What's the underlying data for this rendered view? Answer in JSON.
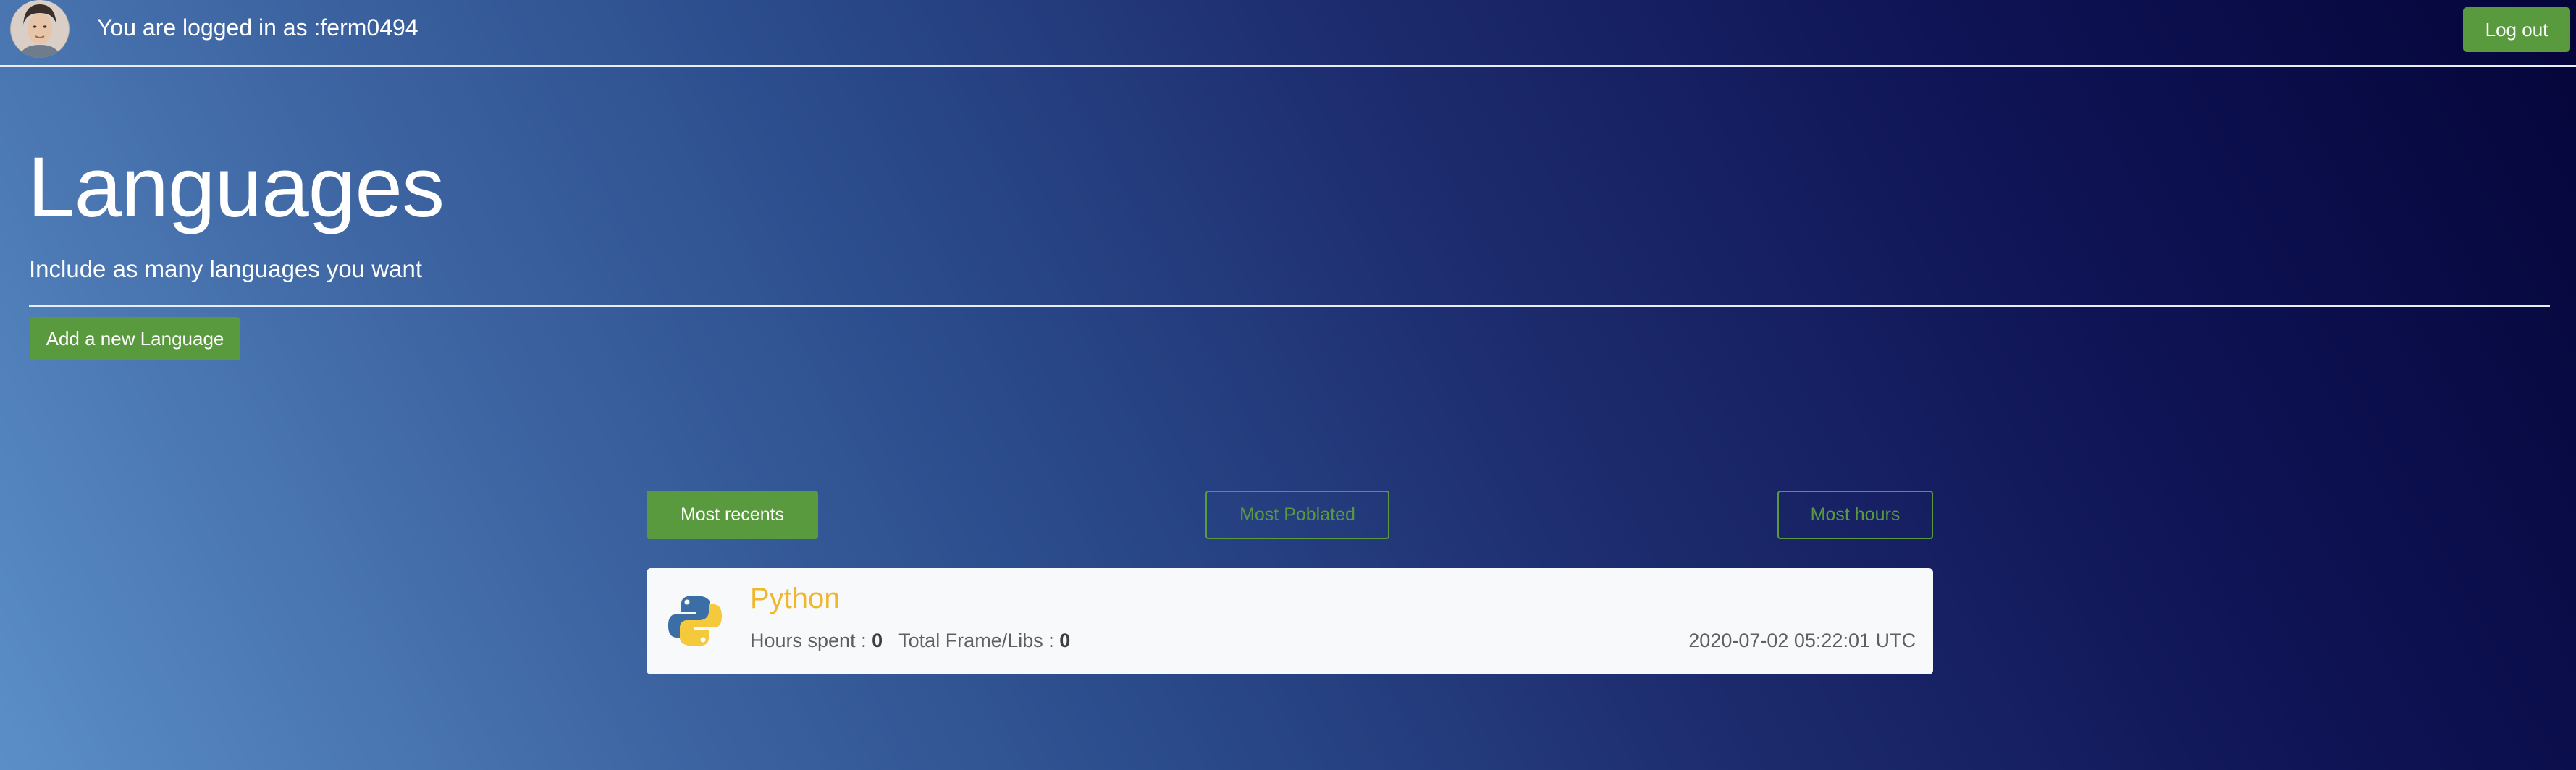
{
  "header": {
    "status_text": "You are logged in as :ferm0494",
    "logout_label": "Log out"
  },
  "page": {
    "title": "Languages",
    "subtitle": "Include as many languages you want",
    "add_button_label": "Add a new Language"
  },
  "filters": {
    "most_recents": "Most recents",
    "most_populated": "Most Poblated",
    "most_hours": "Most hours",
    "active": "most_recents"
  },
  "languages": [
    {
      "name": "Python",
      "icon": "python-logo-icon",
      "hours_label": "Hours spent :",
      "hours_value": "0",
      "frameworks_label": "Total Frame/Libs :",
      "frameworks_value": "0",
      "timestamp": "2020-07-02 05:22:01 UTC"
    }
  ],
  "colors": {
    "accent_green": "#5a9a3e",
    "title_yellow": "#f0b72c",
    "card_background": "#f8f9fa"
  }
}
